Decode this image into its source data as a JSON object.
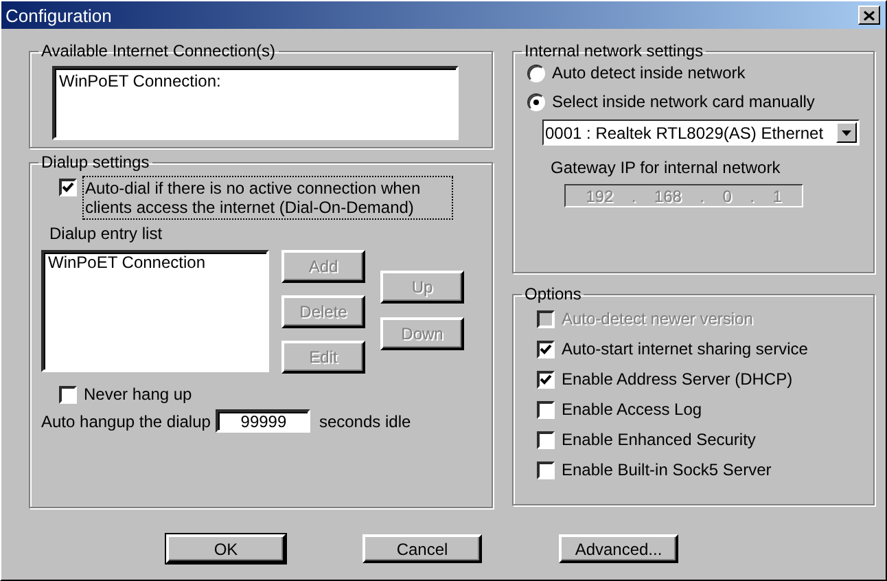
{
  "window": {
    "title": "Configuration"
  },
  "connections": {
    "label": "Available Internet Connection(s)",
    "items": [
      "WinPoET Connection:"
    ]
  },
  "dialup": {
    "label": "Dialup settings",
    "auto_dial": {
      "label": "Auto-dial if there is no active connection when clients access the internet (Dial-On-Demand)",
      "checked": true,
      "focused": true
    },
    "entry_list_label": "Dialup entry list",
    "entries": [
      "WinPoET Connection"
    ],
    "edit_buttons": [
      {
        "label": "Add",
        "disabled": true
      },
      {
        "label": "Delete",
        "disabled": true
      },
      {
        "label": "Edit",
        "disabled": true
      }
    ],
    "move_buttons": [
      {
        "label": "Up",
        "disabled": true
      },
      {
        "label": "Down",
        "disabled": true
      }
    ],
    "never_hang_up": {
      "label": "Never hang up",
      "checked": false
    },
    "hangup": {
      "prefix": "Auto hangup the dialup",
      "value": "99999",
      "suffix": "seconds idle"
    }
  },
  "internal": {
    "label": "Internal network settings",
    "modes": [
      {
        "label": "Auto detect inside network",
        "selected": false
      },
      {
        "label": "Select inside network card manually",
        "selected": true
      }
    ],
    "adapter": "0001 : Realtek RTL8029(AS) Ethernet",
    "gateway_label": "Gateway IP for internal network",
    "gateway_ip": {
      "octets": [
        "192",
        "168",
        "0",
        "1"
      ],
      "separator": ".",
      "disabled": true
    }
  },
  "options": {
    "label": "Options",
    "items": [
      {
        "label": "Auto-detect newer version",
        "checked": false,
        "disabled": true
      },
      {
        "label": "Auto-start internet sharing service",
        "checked": true,
        "disabled": false
      },
      {
        "label": "Enable Address Server (DHCP)",
        "checked": true,
        "disabled": false
      },
      {
        "label": "Enable Access Log",
        "checked": false,
        "disabled": false
      },
      {
        "label": "Enable Enhanced Security",
        "checked": false,
        "disabled": false
      },
      {
        "label": "Enable Built-in Sock5 Server",
        "checked": false,
        "disabled": false
      }
    ]
  },
  "buttons": [
    {
      "label": "OK",
      "default": true
    },
    {
      "label": "Cancel",
      "default": false
    },
    {
      "label": "Advanced...",
      "default": false
    }
  ]
}
